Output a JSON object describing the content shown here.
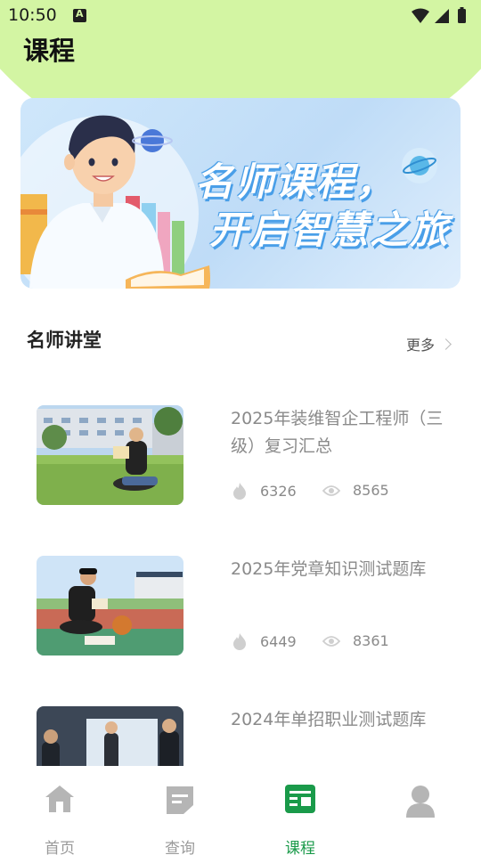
{
  "status": {
    "time": "10:50"
  },
  "page": {
    "title": "课程"
  },
  "banner": {
    "line1": "名师课程，",
    "line2": "开启智慧之旅"
  },
  "section": {
    "title": "名师讲堂",
    "more_label": "更多"
  },
  "courses": [
    {
      "title": "2025年装维智企工程师（三级）复习汇总",
      "hot": "6326",
      "views": "8565"
    },
    {
      "title": "2025年党章知识测试题库",
      "hot": "6449",
      "views": "8361"
    },
    {
      "title": "2024年单招职业测试题库",
      "hot": "",
      "views": ""
    }
  ],
  "nav": {
    "items": [
      {
        "label": "首页",
        "icon": "home-icon"
      },
      {
        "label": "查询",
        "icon": "document-icon"
      },
      {
        "label": "课程",
        "icon": "course-icon",
        "active": true
      },
      {
        "label": "",
        "icon": "profile-icon"
      }
    ]
  },
  "colors": {
    "accent": "#1a9a4a",
    "header_bg": "#d3f5a3"
  }
}
